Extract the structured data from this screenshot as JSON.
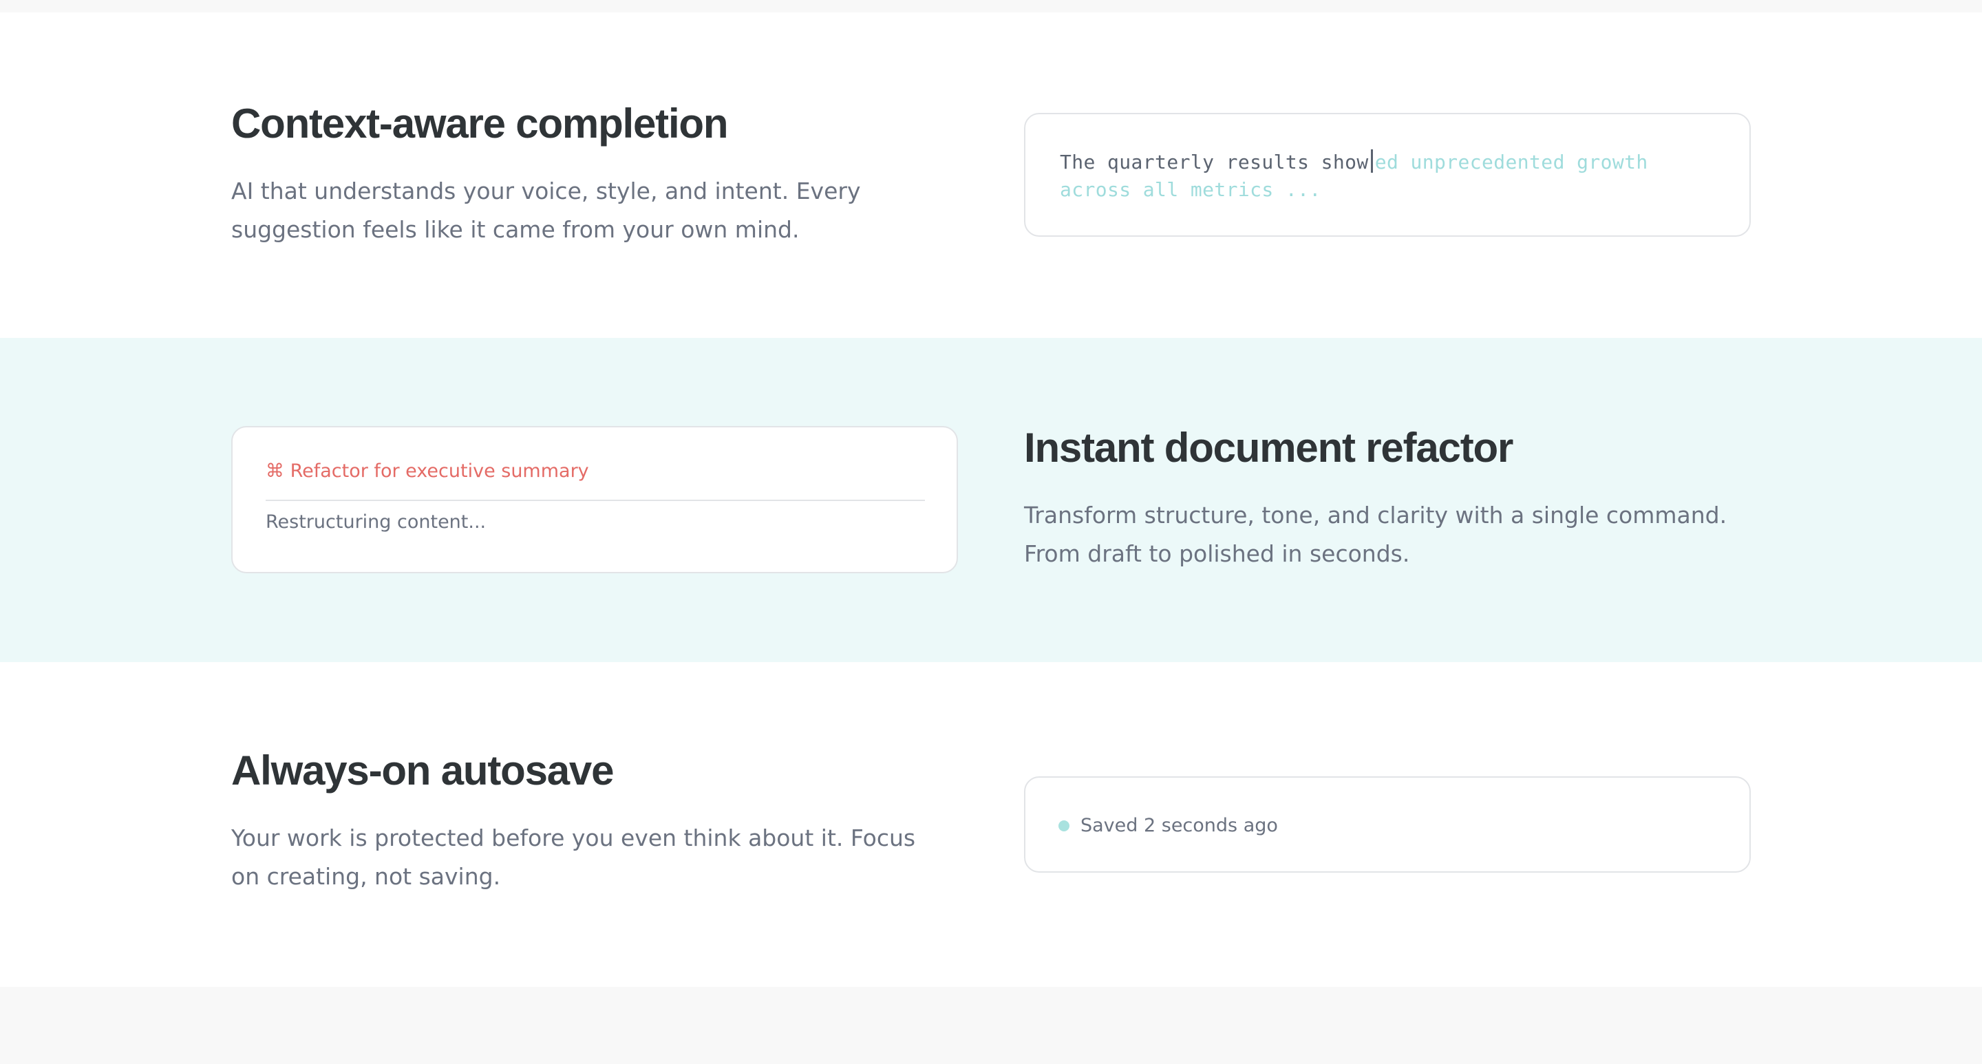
{
  "features": [
    {
      "title": "Context-aware completion",
      "description": "AI that understands your voice, style, and intent. Every suggestion feels like it came from your own mind.",
      "demo": {
        "typed_text": "The quarterly results show",
        "suggestion_text": "ed unprecedented growth across all metrics ..."
      }
    },
    {
      "title": "Instant document refactor",
      "description": "Transform structure, tone, and clarity with a single command. From draft to polished in seconds.",
      "demo": {
        "command_icon": "⌘",
        "command_label": "Refactor for executive summary",
        "status_text": "Restructuring content..."
      }
    },
    {
      "title": "Always-on autosave",
      "description": "Your work is protected before you even think about it. Focus on creating, not saving.",
      "demo": {
        "status_text": "Saved 2 seconds ago"
      }
    }
  ],
  "colors": {
    "heading": "#2f3437",
    "body_text": "#6b7280",
    "accent_teal": "#9fdcdc",
    "accent_red": "#e46b66",
    "highlight_background": "#ecf9f9"
  }
}
